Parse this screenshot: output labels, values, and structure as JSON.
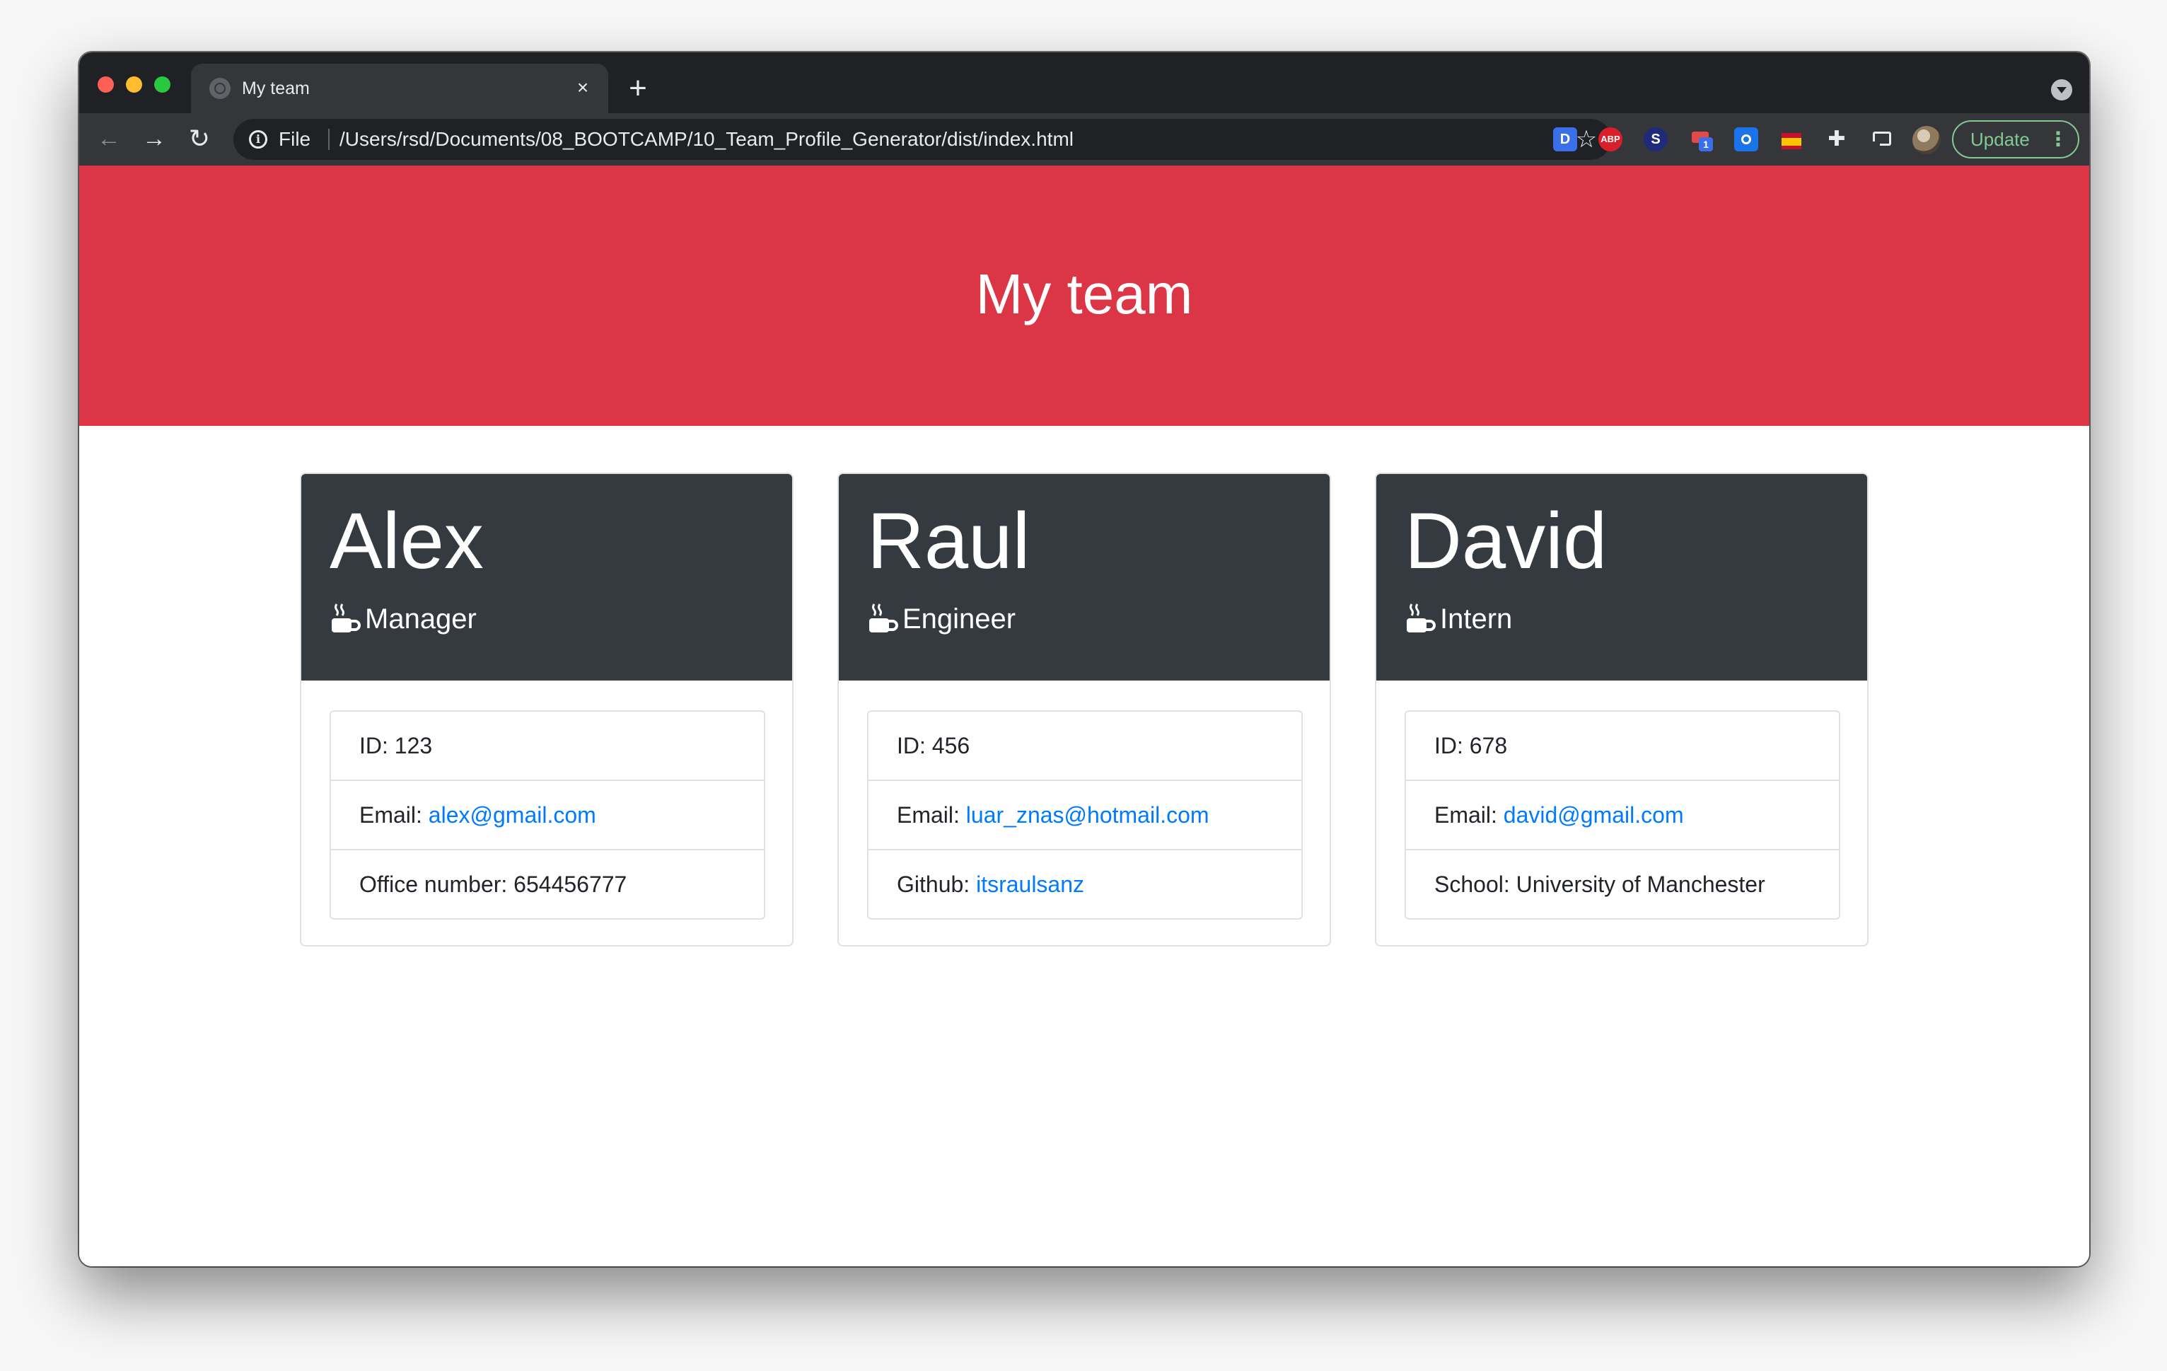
{
  "browser": {
    "tab_title": "My team",
    "close_icon": "×",
    "new_tab_icon": "+",
    "url_scheme": "File",
    "url": "/Users/rsd/Documents/08_BOOTCAMP/10_Team_Profile_Generator/dist/index.html",
    "extensions": [
      "D",
      "ABP",
      "S",
      "1"
    ],
    "update_label": "Update",
    "colors": {
      "frame": "#202124",
      "toolbar": "#35363a",
      "update_green": "#81c995"
    }
  },
  "page": {
    "title": "My team",
    "header_color": "#dc3545",
    "card_header_color": "#343a40",
    "link_color": "#007bff"
  },
  "team": [
    {
      "name": "Alex",
      "role": "Manager",
      "id_label": "ID: 123",
      "email_label": "Email: ",
      "email": "alex@gmail.com",
      "extra_label": "Office number: 654456777",
      "extra_value": ""
    },
    {
      "name": "Raul",
      "role": "Engineer",
      "id_label": "ID: 456",
      "email_label": "Email: ",
      "email": "luar_znas@hotmail.com",
      "extra_label": "Github: ",
      "extra_value": "itsraulsanz"
    },
    {
      "name": "David",
      "role": "Intern",
      "id_label": "ID: 678",
      "email_label": "Email: ",
      "email": "david@gmail.com",
      "extra_label": "School: University of Manchester",
      "extra_value": ""
    }
  ]
}
